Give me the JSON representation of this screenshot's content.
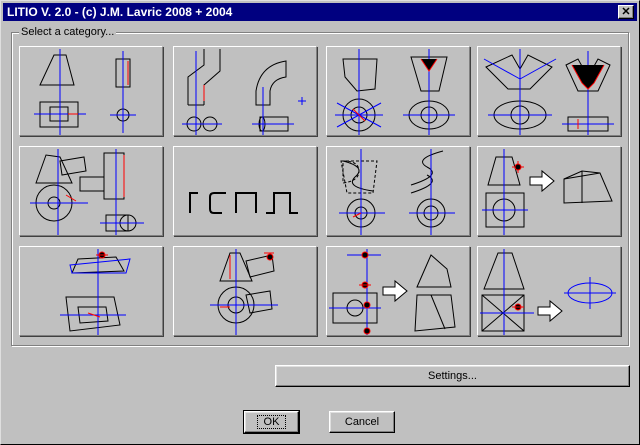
{
  "window": {
    "title": "LITIO V. 2.0 - (c) J.M. Lavric 2008 + 2004",
    "close_glyph": "✕"
  },
  "group": {
    "label": "Select a category..."
  },
  "tiles": [
    {
      "name": "category-1"
    },
    {
      "name": "category-2"
    },
    {
      "name": "category-3"
    },
    {
      "name": "category-4"
    },
    {
      "name": "category-5"
    },
    {
      "name": "category-6"
    },
    {
      "name": "category-7"
    },
    {
      "name": "category-8"
    },
    {
      "name": "category-9"
    },
    {
      "name": "category-10"
    },
    {
      "name": "category-11"
    },
    {
      "name": "category-12"
    }
  ],
  "buttons": {
    "settings": "Settings...",
    "ok": "OK",
    "cancel": "Cancel"
  },
  "colors": {
    "title_bg": "#000080",
    "axis": "#0000ff",
    "accent": "#ff0000"
  }
}
